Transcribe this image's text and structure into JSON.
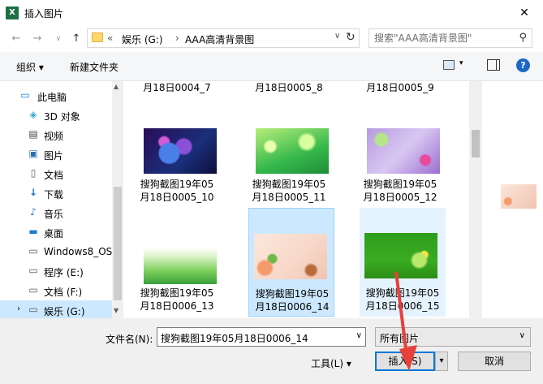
{
  "window": {
    "title": "插入图片",
    "app_icon": "X"
  },
  "address": {
    "overflow": "«",
    "crumbs": [
      "娱乐 (G:)",
      "AAA高清背景图"
    ],
    "search_placeholder": "搜索\"AAA高清背景图\""
  },
  "toolbar": {
    "organize": "组织 ▾",
    "new_folder": "新建文件夹"
  },
  "sidebar": {
    "items": [
      {
        "label": "此电脑",
        "icon": "computer-icon"
      },
      {
        "label": "3D 对象",
        "icon": "cube-icon"
      },
      {
        "label": "视频",
        "icon": "video-icon"
      },
      {
        "label": "图片",
        "icon": "picture-icon"
      },
      {
        "label": "文档",
        "icon": "document-icon"
      },
      {
        "label": "下载",
        "icon": "download-icon"
      },
      {
        "label": "音乐",
        "icon": "music-icon"
      },
      {
        "label": "桌面",
        "icon": "desktop-icon"
      },
      {
        "label": "Windows8_OS",
        "icon": "drive-icon"
      },
      {
        "label": "程序 (E:)",
        "icon": "drive-icon"
      },
      {
        "label": "文档 (F:)",
        "icon": "drive-icon"
      },
      {
        "label": "娱乐 (G:)",
        "icon": "drive-icon"
      }
    ]
  },
  "files": {
    "partial_row": [
      "月18日0004_7",
      "月18日0005_8",
      "月18日0005_9"
    ],
    "items": [
      {
        "line1": "搜狗截图19年05",
        "line2": "月18日0005_10"
      },
      {
        "line1": "搜狗截图19年05",
        "line2": "月18日0005_11"
      },
      {
        "line1": "搜狗截图19年05",
        "line2": "月18日0005_12"
      },
      {
        "line1": "搜狗截图19年05",
        "line2": "月18日0006_13"
      },
      {
        "line1": "搜狗截图19年05",
        "line2": "月18日0006_14"
      },
      {
        "line1": "搜狗截图19年05",
        "line2": "月18日0006_15"
      }
    ]
  },
  "bottom": {
    "filename_label": "文件名(N):",
    "filename_value": "搜狗截图19年05月18日0006_14",
    "filetype_value": "所有图片",
    "tools": "工具(L)  ▾",
    "insert": "插入(S)",
    "cancel": "取消"
  },
  "colors": {
    "selection": "#cce8ff",
    "accent": "#0078d7",
    "arrow": "#e8403a"
  }
}
